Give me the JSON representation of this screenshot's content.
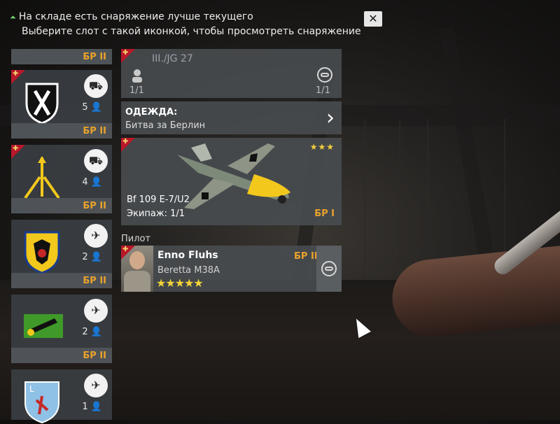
{
  "notification": {
    "line1": "На складе есть снаряжение лучше текущего",
    "line2": "Выберите слот с такой иконкой, чтобы просмотреть снаряжение",
    "icon": "double-chevron-up-icon",
    "close_icon": "close-icon"
  },
  "left_cards": [
    {
      "br": "БР II"
    },
    {
      "crew": "5",
      "br": "БР II",
      "type": "tank",
      "emblem": "shield-x-emblem"
    },
    {
      "crew": "4",
      "br": "БР II",
      "type": "tank",
      "emblem": "arrows-emblem"
    },
    {
      "crew": "2",
      "br": "БР II",
      "type": "plane",
      "emblem": "eagle-shield-emblem"
    },
    {
      "crew": "2",
      "br": "БР II",
      "type": "plane",
      "emblem": "green-plane-emblem"
    },
    {
      "crew": "1",
      "br": "",
      "type": "plane",
      "emblem": "blue-shield-emblem"
    }
  ],
  "unit": {
    "name": "III./JG 27",
    "left_count": "1/1",
    "right_count": "1/1"
  },
  "clothing": {
    "title": "ОДЕЖДА:",
    "name": "Битва за Берлин"
  },
  "aircraft": {
    "name": "Bf 109 E-7/U2",
    "crew": "Экипаж: 1/1",
    "br": "БР I",
    "stars": "★★★"
  },
  "pilot": {
    "section_label": "Пилот",
    "name": "Enno Fluhs",
    "weapon": "Beretta M38A",
    "br": "БР II",
    "stars": "★★★★★"
  },
  "colors": {
    "accent": "#e9a22b",
    "corner": "#b8182a",
    "star": "#f2d23a"
  }
}
